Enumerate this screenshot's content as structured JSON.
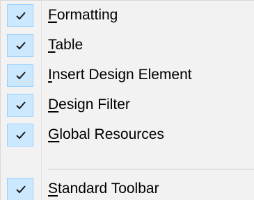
{
  "menu": {
    "items": [
      {
        "acc": "F",
        "rest": "ormatting",
        "checked": true
      },
      {
        "acc": "T",
        "rest": "able",
        "checked": true
      },
      {
        "acc": "I",
        "rest": "nsert Design Element",
        "checked": true
      },
      {
        "acc": "D",
        "rest": "esign Filter",
        "checked": true
      },
      {
        "acc": "G",
        "rest": "lobal Resources",
        "checked": true
      }
    ],
    "separator_after": 5,
    "last_item": {
      "acc": "S",
      "rest": "tandard Toolbar",
      "checked": true
    }
  },
  "colors": {
    "check_background": "#cce8ff",
    "check_border": "#99d1ff",
    "menu_background": "#f2f2f2"
  },
  "icons": {
    "check": "checkmark-icon"
  }
}
